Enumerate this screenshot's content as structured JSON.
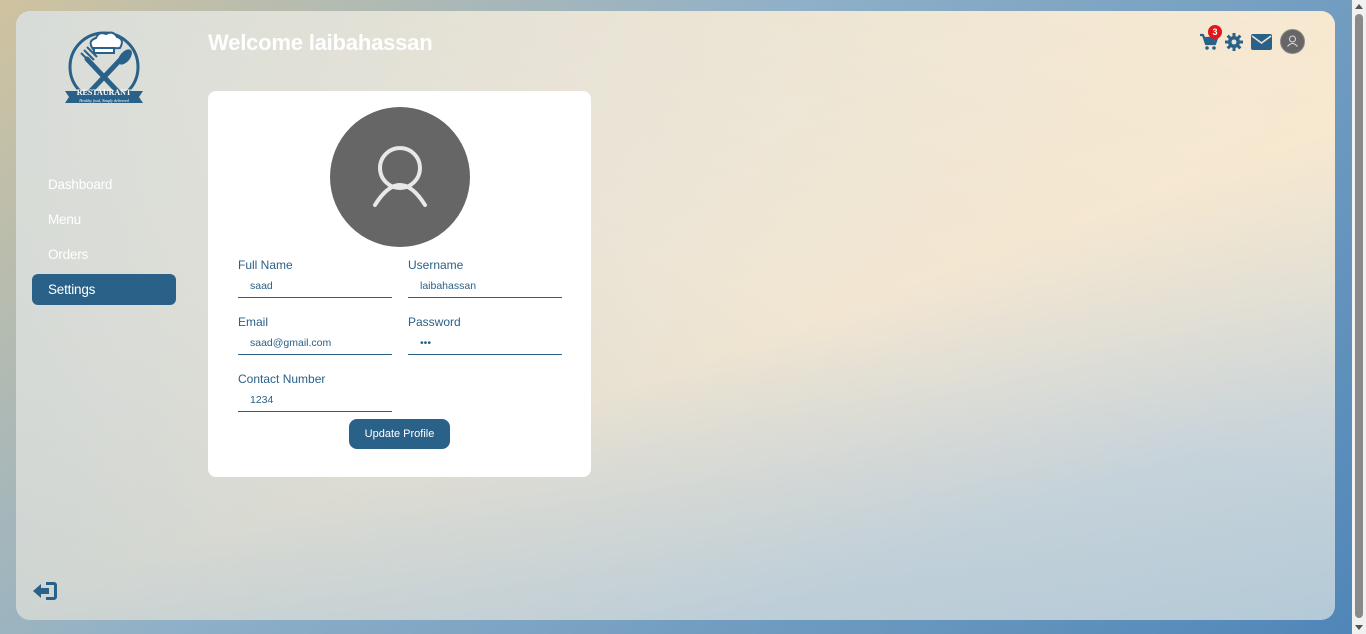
{
  "app": {
    "logo_text": "RESTAURANT",
    "logo_tagline": "Healthy food, Simply delivered"
  },
  "header": {
    "welcome": "Welcome laibahassan",
    "cart_count": "3"
  },
  "sidebar": {
    "items": [
      {
        "label": "Dashboard",
        "active": false
      },
      {
        "label": "Menu",
        "active": false
      },
      {
        "label": "Orders",
        "active": false
      },
      {
        "label": "Settings",
        "active": true
      }
    ]
  },
  "profile": {
    "fields": {
      "full_name": {
        "label": "Full Name",
        "value": "saad"
      },
      "username": {
        "label": "Username",
        "value": "laibahassan"
      },
      "email": {
        "label": "Email",
        "value": "saad@gmail.com"
      },
      "password": {
        "label": "Password",
        "value": "•••"
      },
      "contact": {
        "label": "Contact Number",
        "value": "1234"
      }
    },
    "update_label": "Update Profile"
  },
  "colors": {
    "primary": "#2a6188",
    "badge": "#e01818",
    "avatar": "#666666"
  },
  "icons": [
    "cart-icon",
    "gear-icon",
    "mail-icon",
    "user-avatar-icon",
    "logout-icon",
    "user-icon"
  ]
}
